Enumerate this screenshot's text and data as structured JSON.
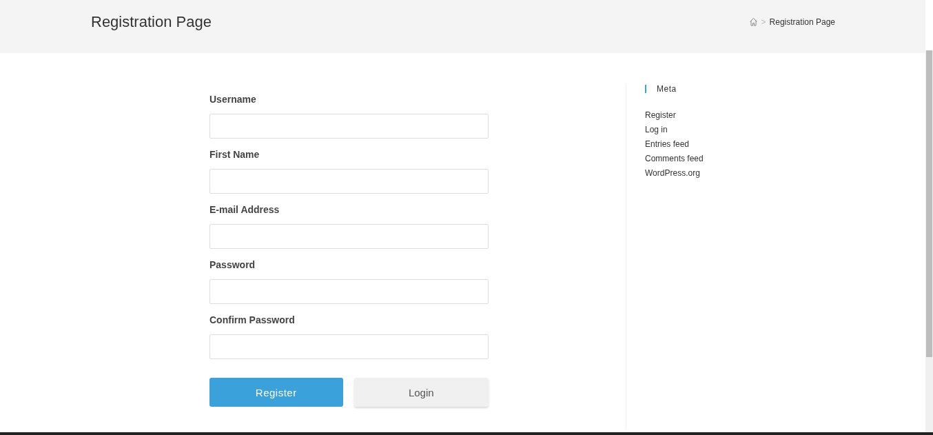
{
  "header": {
    "title": "Registration Page",
    "breadcrumb": {
      "separator": ">",
      "current": "Registration Page"
    }
  },
  "form": {
    "fields": [
      {
        "label": "Username"
      },
      {
        "label": "First Name"
      },
      {
        "label": "E-mail Address"
      },
      {
        "label": "Password"
      },
      {
        "label": "Confirm Password"
      }
    ],
    "buttons": [
      {
        "label": "Register",
        "kind": "primary"
      },
      {
        "label": "Login",
        "kind": "secondary"
      }
    ]
  },
  "sidebar": {
    "title": "Meta",
    "links": [
      "Register",
      "Log in",
      "Entries feed",
      "Comments feed",
      "WordPress.org"
    ]
  }
}
